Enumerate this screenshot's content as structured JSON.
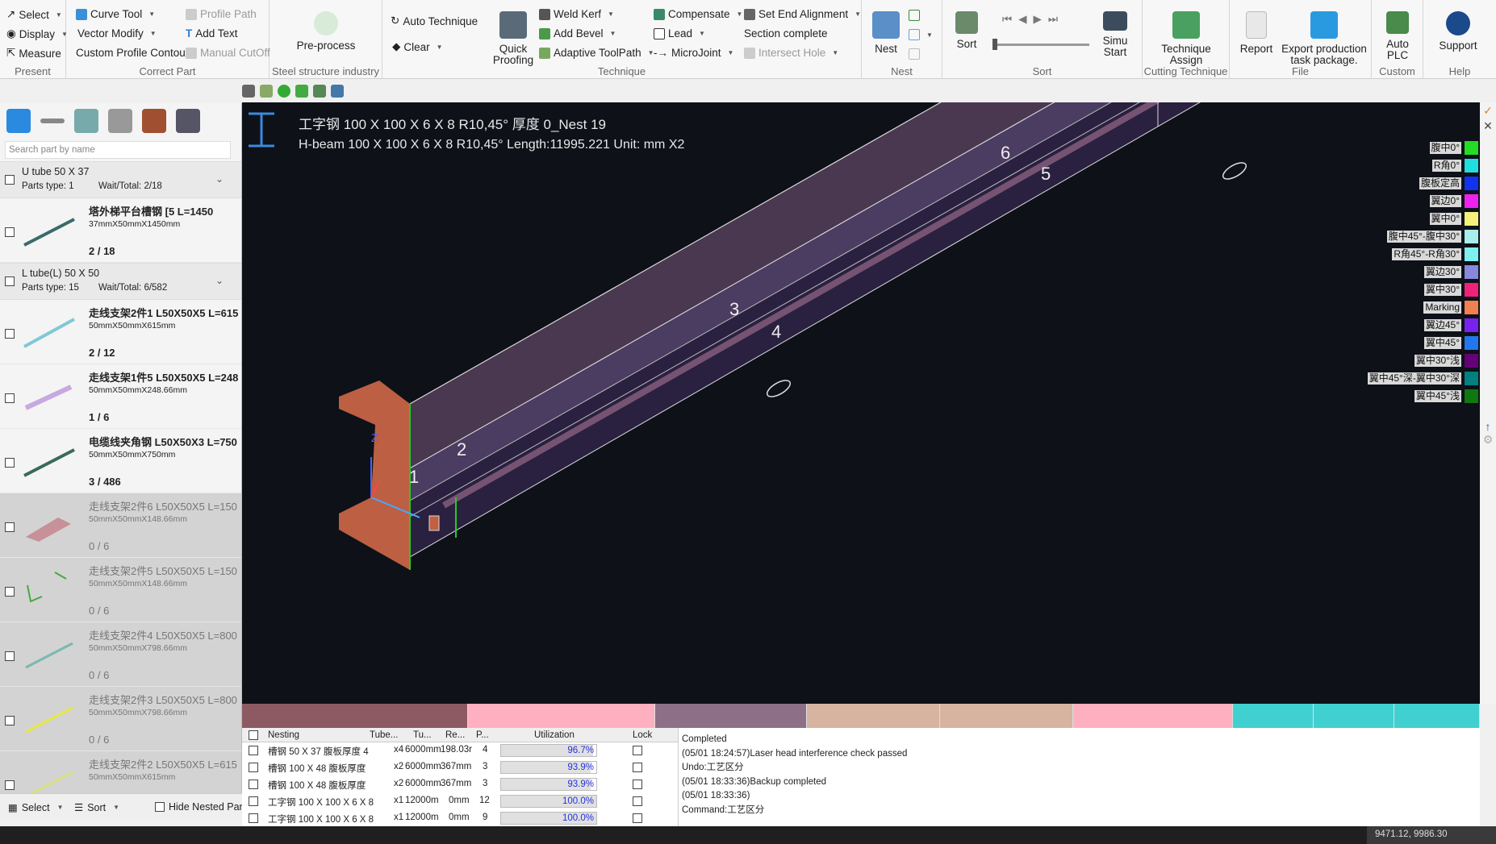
{
  "ribbon": {
    "present": {
      "select": "Select",
      "display": "Display",
      "measure": "Measure",
      "label": "Present"
    },
    "correct_part": {
      "curve_tool": "Curve Tool",
      "vector_modify": "Vector Modify",
      "custom_profile": "Custom Profile Contour",
      "profile_path": "Profile Path",
      "add_text": "Add Text",
      "manual_cutoff": "Manual CutOff",
      "label": "Correct Part"
    },
    "steel": {
      "preprocess": "Pre-process",
      "label": "Steel structure industry"
    },
    "technique": {
      "auto_technique": "Auto Technique",
      "clear": "Clear",
      "quick_proofing": "Quick Proofing",
      "weld_kerf": "Weld Kerf",
      "add_bevel": "Add Bevel",
      "adaptive_toolpath": "Adaptive ToolPath",
      "compensate": "Compensate",
      "lead": "Lead",
      "microjoint": "MicroJoint",
      "set_end_alignment": "Set End Alignment",
      "section_complete": "Section complete",
      "intersect_hole": "Intersect Hole",
      "label": "Technique"
    },
    "nest": {
      "nest": "Nest",
      "label": "Nest"
    },
    "sort": {
      "sort": "Sort",
      "simu_start": "Simu Start",
      "label": "Sort"
    },
    "cutting": {
      "technique_assign": "Technique Assign",
      "label": "Cutting Technique"
    },
    "file": {
      "report": "Report",
      "export": "Export production task package.",
      "label": "File"
    },
    "custom": {
      "auto_plc": "Auto PLC",
      "label": "Custom"
    },
    "help": {
      "support": "Support",
      "label": "Help"
    }
  },
  "left": {
    "search_placeholder": "Search part by name",
    "groups": [
      {
        "name": "U tube 50 X 37",
        "types": "Parts type:  1",
        "wait": "Wait/Total: 2/18"
      },
      {
        "name": "L tube(L) 50 X 50",
        "types": "Parts type:  15",
        "wait": "Wait/Total: 6/582"
      }
    ],
    "parts": [
      {
        "name": "塔外梯平台槽钢  [5    L=1450",
        "size": "37mmX50mmX1450mm",
        "count": "2 / 18"
      },
      {
        "name": "走线支架2件1  L50X50X5  L=615",
        "size": "50mmX50mmX615mm",
        "count": "2 / 12"
      },
      {
        "name": "走线支架1件5  L50X50X5  L=248",
        "size": "50mmX50mmX248.66mm",
        "count": "1 / 6"
      },
      {
        "name": "电缆线夹角钢  L50X50X3  L=750",
        "size": "50mmX50mmX750mm",
        "count": "3 / 486"
      },
      {
        "name": "走线支架2件6  L50X50X5  L=150",
        "size": "50mmX50mmX148.66mm",
        "count": "0 / 6"
      },
      {
        "name": "走线支架2件5  L50X50X5  L=150",
        "size": "50mmX50mmX148.66mm",
        "count": "0 / 6"
      },
      {
        "name": "走线支架2件4  L50X50X5  L=800",
        "size": "50mmX50mmX798.66mm",
        "count": "0 / 6"
      },
      {
        "name": "走线支架2件3  L50X50X5  L=800",
        "size": "50mmX50mmX798.66mm",
        "count": "0 / 6"
      },
      {
        "name": "走线支架2件2  L50X50X5  L=615",
        "size": "50mmX50mmX615mm",
        "count": ""
      }
    ],
    "bottom": {
      "select": "Select",
      "sort": "Sort",
      "hide": "Hide Nested Part"
    }
  },
  "viewport": {
    "title_cn": "工字钢 100 X 100 X 6 X 8  R10,45° 厚度 0_Nest 19",
    "title_en": "H-beam 100 X 100 X 6 X 8  R10,45° Length:11995.221 Unit: mm  X2",
    "labels": [
      "1",
      "2",
      "3",
      "4",
      "5",
      "6"
    ],
    "axis_z": "Z"
  },
  "legend": [
    {
      "text": "腹中0°",
      "color": "#22dd22"
    },
    {
      "text": "R角0°",
      "color": "#22dddd"
    },
    {
      "text": "腹板定高",
      "color": "#1133ee"
    },
    {
      "text": "翼边0°",
      "color": "#ee22ee"
    },
    {
      "text": "翼中0°",
      "color": "#f4f07a"
    },
    {
      "text": "腹中45°-腹中30°",
      "color": "#a8ecec"
    },
    {
      "text": "R角45°-R角30°",
      "color": "#7ef0f0"
    },
    {
      "text": "翼边30°",
      "color": "#8888dd"
    },
    {
      "text": "翼中30°",
      "color": "#ee2277"
    },
    {
      "text": "Marking",
      "color": "#f08050"
    },
    {
      "text": "翼边45°",
      "color": "#7722ee"
    },
    {
      "text": "翼中45°",
      "color": "#2277ee"
    },
    {
      "text": "翼中30°浅",
      "color": "#660077"
    },
    {
      "text": "翼中45°深-翼中30°深",
      "color": "#008080"
    },
    {
      "text": "翼中45°浅",
      "color": "#117711"
    }
  ],
  "strip_colors": [
    "#8d5a64",
    "#ffb0c0",
    "#8d7088",
    "#d6b4a0",
    "#d6b4a0",
    "#ffb0c0",
    "#40d0d0",
    "#40d0d0",
    "#40d0d0"
  ],
  "nest_table": {
    "headers": [
      "Nesting",
      "Tube...",
      "Tu...",
      "Re...",
      "P...",
      "Utilization",
      "Lock"
    ],
    "rows": [
      {
        "name": "槽钢 50 X 37 腹板厚度 4",
        "tube": "x4",
        "len": "6000mm",
        "rem": "198.03r",
        "p": "4",
        "util": "96.7%",
        "fill": 0.967
      },
      {
        "name": "槽钢 100 X 48 腹板厚度",
        "tube": "x2",
        "len": "6000mm",
        "rem": "367mm",
        "p": "3",
        "util": "93.9%",
        "fill": 0.939
      },
      {
        "name": "槽钢 100 X 48 腹板厚度",
        "tube": "x2",
        "len": "6000mm",
        "rem": "367mm",
        "p": "3",
        "util": "93.9%",
        "fill": 0.939
      },
      {
        "name": "工字钢 100 X 100 X 6 X 8",
        "tube": "x1",
        "len": "12000m",
        "rem": "0mm",
        "p": "12",
        "util": "100.0%",
        "fill": 1.0
      },
      {
        "name": "工字钢 100 X 100 X 6 X 8",
        "tube": "x1",
        "len": "12000m",
        "rem": "0mm",
        "p": "9",
        "util": "100.0%",
        "fill": 1.0
      }
    ]
  },
  "log": [
    "Completed",
    "(05/01 18:24:57)Laser head interference check passed",
    "Undo:工艺区分",
    "(05/01 18:33:36)Backup completed",
    "(05/01 18:33:36)",
    "Command:工艺区分"
  ],
  "status": {
    "coords": "9471.12, 9986.30"
  }
}
